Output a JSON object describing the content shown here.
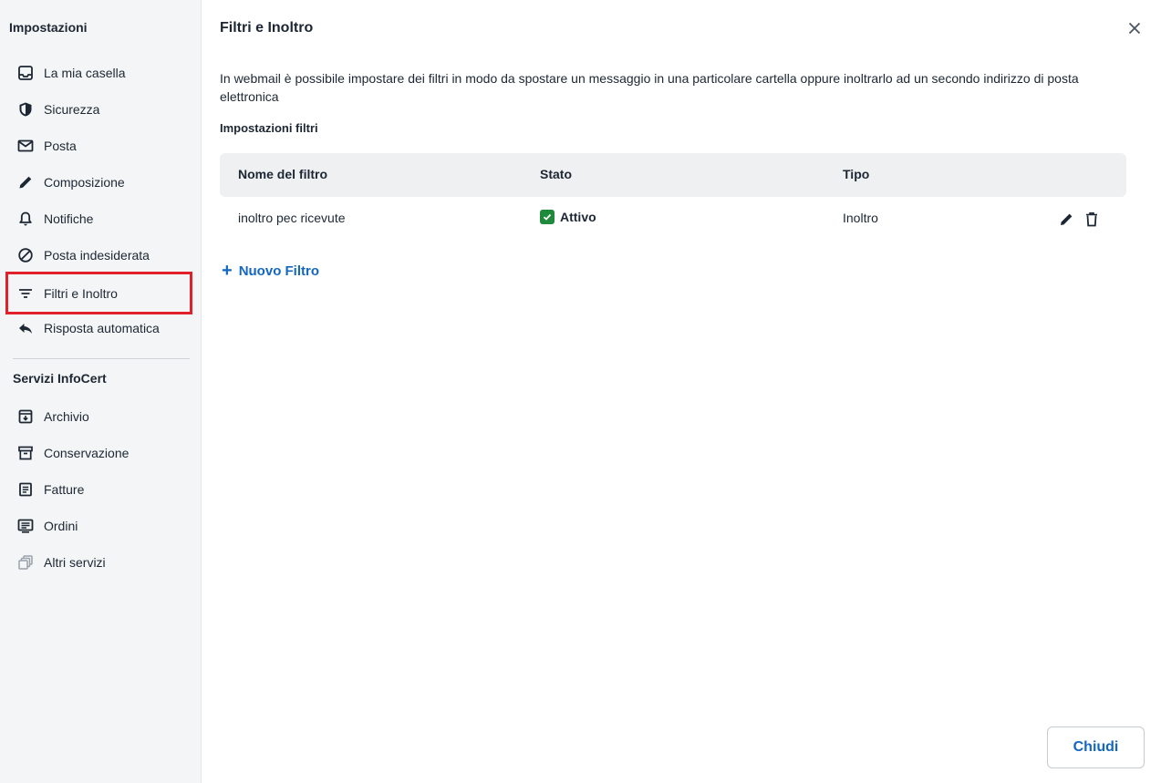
{
  "sidebar": {
    "title": "Impostazioni",
    "items": [
      {
        "label": "La mia casella",
        "icon": "inbox-icon"
      },
      {
        "label": "Sicurezza",
        "icon": "shield-icon"
      },
      {
        "label": "Posta",
        "icon": "mail-icon"
      },
      {
        "label": "Composizione",
        "icon": "pencil-icon"
      },
      {
        "label": "Notifiche",
        "icon": "bell-icon"
      },
      {
        "label": "Posta indesiderata",
        "icon": "block-icon"
      },
      {
        "label": "Filtri e Inoltro",
        "icon": "filter-icon",
        "selected": true
      },
      {
        "label": "Risposta automatica",
        "icon": "reply-icon"
      }
    ],
    "section_title": "Servizi InfoCert",
    "services": [
      {
        "label": "Archivio",
        "icon": "archive-icon"
      },
      {
        "label": "Conservazione",
        "icon": "box-icon"
      },
      {
        "label": "Fatture",
        "icon": "document-icon"
      },
      {
        "label": "Ordini",
        "icon": "list-icon"
      },
      {
        "label": "Altri servizi",
        "icon": "services-icon"
      }
    ]
  },
  "main": {
    "title": "Filtri e Inoltro",
    "description": "In webmail è possibile impostare dei filtri in modo da spostare un messaggio in una particolare cartella oppure inoltrarlo ad un secondo indirizzo di posta elettronica",
    "subheading": "Impostazioni filtri",
    "table": {
      "headers": [
        "Nome del filtro",
        "Stato",
        "Tipo"
      ],
      "rows": [
        {
          "name": "inoltro pec ricevute",
          "status": "Attivo",
          "type": "Inoltro"
        }
      ]
    },
    "new_filter_label": "Nuovo Filtro",
    "close_button_label": "Chiudi"
  },
  "colors": {
    "accent": "#1467c0",
    "active_green": "#1f8a3c",
    "highlight_red": "#e0202a",
    "sidebar_bg": "#f4f5f7"
  }
}
